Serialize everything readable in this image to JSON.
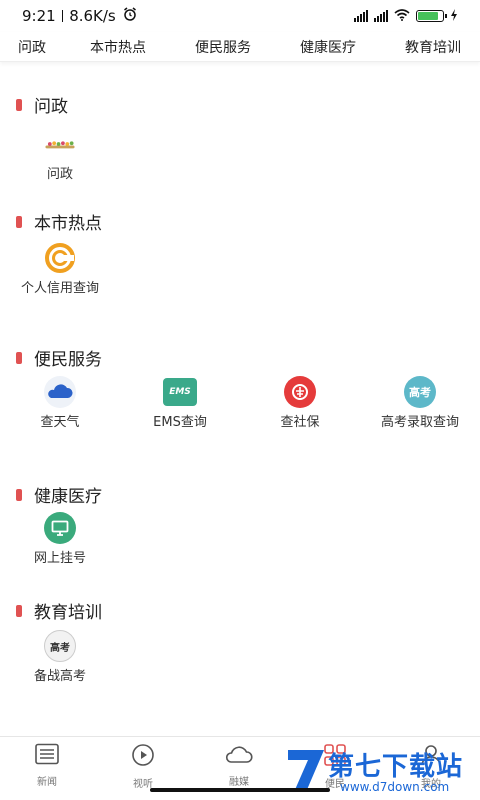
{
  "status_bar": {
    "time": "9:21",
    "speed": "8.6K/s",
    "icons": [
      "alarm-icon",
      "signal-icon",
      "signal-icon",
      "wifi-icon",
      "battery-icon",
      "charging-icon"
    ],
    "battery_level": 0.85,
    "battery_color": "#46c15a"
  },
  "tabs": [
    "问政",
    "本市热点",
    "便民服务",
    "健康医疗",
    "教育培训"
  ],
  "sections": [
    {
      "title": "问政",
      "items": [
        {
          "label": "问政",
          "icon": "flowers-icon"
        }
      ]
    },
    {
      "title": "本市热点",
      "items": [
        {
          "label": "个人信用查询",
          "icon": "credit-icon"
        }
      ]
    },
    {
      "title": "便民服务",
      "items": [
        {
          "label": "查天气",
          "icon": "weather-cloud-icon"
        },
        {
          "label": "EMS查询",
          "icon": "ems-icon",
          "icon_text": "EMS"
        },
        {
          "label": "查社保",
          "icon": "social-security-icon"
        },
        {
          "label": "高考录取查询",
          "icon": "gaokao-icon",
          "icon_text": "高考"
        }
      ]
    },
    {
      "title": "健康医疗",
      "items": [
        {
          "label": "网上挂号",
          "icon": "monitor-icon"
        }
      ]
    },
    {
      "title": "教育培训",
      "items": [
        {
          "label": "备战高考",
          "icon": "exam-prep-icon",
          "icon_text": "高考"
        }
      ]
    }
  ],
  "bottom_nav": [
    {
      "label": "新闻",
      "icon": "news-list-icon"
    },
    {
      "label": "视听",
      "icon": "play-icon"
    },
    {
      "label": "融媒",
      "icon": "cloud-icon"
    },
    {
      "label": "便民",
      "icon": "grid-icon",
      "active": true
    },
    {
      "label": "我的",
      "icon": "user-icon"
    }
  ],
  "watermark": {
    "title": "第七下载站",
    "url": "www.d7down.com"
  },
  "colors": {
    "section_bar": "#e05252",
    "watermark": "#1b67d6",
    "active_nav": "#e05252"
  }
}
